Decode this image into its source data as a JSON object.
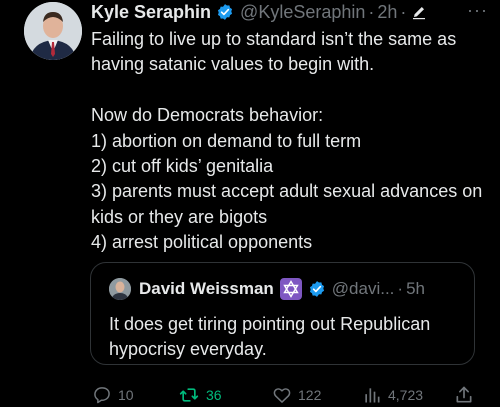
{
  "post": {
    "author_name": "Kyle Seraphin",
    "author_handle": "@KyleSeraphin",
    "separator": "·",
    "time": "2h",
    "more": "···",
    "paragraph1": "Failing to live up to standard isn’t the same as having satanic values to begin with.",
    "paragraph2_lines": [
      "Now do Democrats behavior:",
      "1) abortion on demand to full term",
      "2) cut off kids’ genitalia",
      "3) parents must accept adult sexual advances on kids or they are bigots",
      "4) arrest political opponents"
    ]
  },
  "quote": {
    "author_name": "David Weissman",
    "author_handle": "@davi...",
    "separator": "·",
    "time": "5h",
    "text": "It does get tiring pointing out Republican hypocrisy everyday."
  },
  "actions": {
    "replies": "10",
    "reposts": "36",
    "likes": "122",
    "views": "4,723"
  },
  "colors": {
    "background": "#000000",
    "text": "#e7e9ea",
    "secondary": "#71767b",
    "verified": "#1d9bf0",
    "repost_active": "#00ba7c",
    "star_badge": "#7e57c2"
  }
}
